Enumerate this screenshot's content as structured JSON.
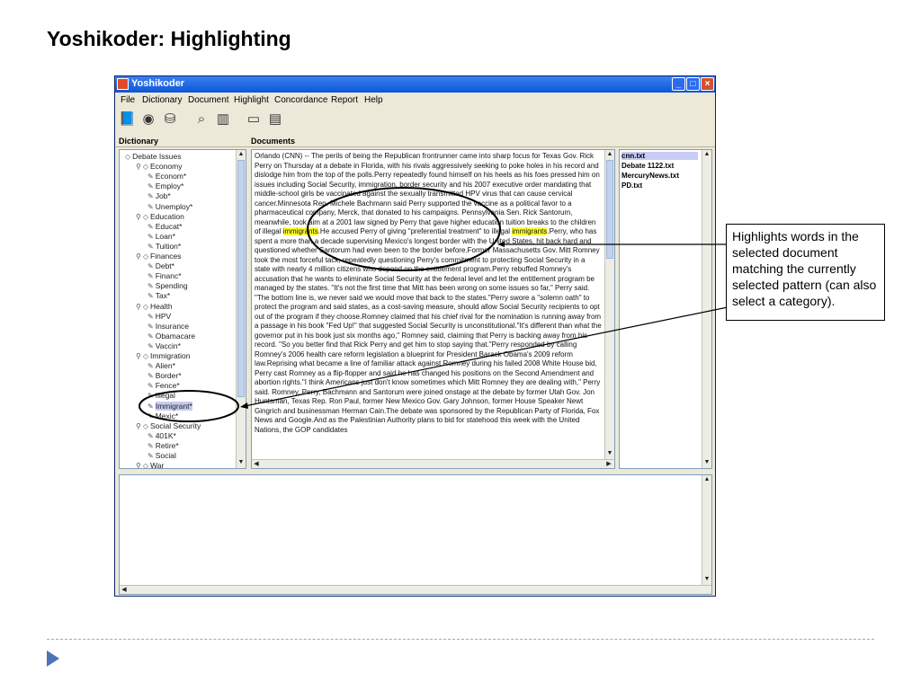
{
  "slide": {
    "title": "Yoshikoder: Highlighting"
  },
  "window": {
    "title": "Yoshikoder",
    "menus": [
      "File",
      "Dictionary",
      "Document",
      "Highlight",
      "Concordance",
      "Report",
      "Help"
    ],
    "toolbar_icons": [
      "book-icon",
      "open-document-icon",
      "jar-icon",
      "magnifier-icon",
      "columns-icon",
      "clipboard-icon",
      "export-icon"
    ]
  },
  "dictionary": {
    "label": "Dictionary",
    "tree": [
      {
        "text": "Debate Issues",
        "level": 0,
        "kind": "category"
      },
      {
        "text": "Economy",
        "level": 1,
        "kind": "category"
      },
      {
        "text": "Econom*",
        "level": 2,
        "kind": "pattern"
      },
      {
        "text": "Employ*",
        "level": 2,
        "kind": "pattern"
      },
      {
        "text": "Job*",
        "level": 2,
        "kind": "pattern"
      },
      {
        "text": "Unemploy*",
        "level": 2,
        "kind": "pattern"
      },
      {
        "text": "Education",
        "level": 1,
        "kind": "category"
      },
      {
        "text": "Educat*",
        "level": 2,
        "kind": "pattern"
      },
      {
        "text": "Loan*",
        "level": 2,
        "kind": "pattern"
      },
      {
        "text": "Tuition*",
        "level": 2,
        "kind": "pattern"
      },
      {
        "text": "Finances",
        "level": 1,
        "kind": "category"
      },
      {
        "text": "Debt*",
        "level": 2,
        "kind": "pattern"
      },
      {
        "text": "Financ*",
        "level": 2,
        "kind": "pattern"
      },
      {
        "text": "Spending",
        "level": 2,
        "kind": "pattern"
      },
      {
        "text": "Tax*",
        "level": 2,
        "kind": "pattern"
      },
      {
        "text": "Health",
        "level": 1,
        "kind": "category"
      },
      {
        "text": "HPV",
        "level": 2,
        "kind": "pattern"
      },
      {
        "text": "Insurance",
        "level": 2,
        "kind": "pattern"
      },
      {
        "text": "Obamacare",
        "level": 2,
        "kind": "pattern"
      },
      {
        "text": "Vaccin*",
        "level": 2,
        "kind": "pattern"
      },
      {
        "text": "Immigration",
        "level": 1,
        "kind": "category"
      },
      {
        "text": "Alien*",
        "level": 2,
        "kind": "pattern"
      },
      {
        "text": "Border*",
        "level": 2,
        "kind": "pattern"
      },
      {
        "text": "Fence*",
        "level": 2,
        "kind": "pattern"
      },
      {
        "text": "Illegal",
        "level": 2,
        "kind": "pattern"
      },
      {
        "text": "Immigrant*",
        "level": 2,
        "kind": "pattern",
        "selected": true
      },
      {
        "text": "Mexic*",
        "level": 2,
        "kind": "pattern"
      },
      {
        "text": "Social Security",
        "level": 1,
        "kind": "category"
      },
      {
        "text": "401K*",
        "level": 2,
        "kind": "pattern"
      },
      {
        "text": "Retire*",
        "level": 2,
        "kind": "pattern"
      },
      {
        "text": "Social",
        "level": 2,
        "kind": "pattern"
      },
      {
        "text": "War",
        "level": 1,
        "kind": "category"
      }
    ]
  },
  "documents": {
    "label": "Documents",
    "text_before_1": "Orlando (CNN) -- The perils of being the Republican frontrunner came into sharp focus for Texas Gov. Rick Perry on Thursday at a debate in Florida, with his rivals aggressively seeking to poke holes in his record and dislodge him from the top of the polls.Perry repeatedly found himself on his heels as his foes pressed him on issues including Social Security, immigration, border security and his 2007 executive order mandating that middle-school girls be vaccinated against the sexually transmitted HPV virus that can cause cervical cancer.Minnesota Rep. Michele Bachmann said Perry supported the vaccine as a political favor to a pharmaceutical company, Merck, that donated to his campaigns. Pennsylvania Sen. Rick Santorum, meanwhile, took aim at a 2001 law signed by Perry that gave higher education tuition breaks to the children of illegal ",
    "highlight_1": "immigrants",
    "text_between": ".He accused Perry of giving \"preferential treatment\" to illegal ",
    "highlight_2": "immigrants",
    "text_after": ".Perry, who has spent a more than a decade supervising Mexico's longest border with the United States, hit back hard and questioned whether Santorum had even been to the border before.Former Massachusetts Gov. Mitt Romney took the most forceful tack, repeatedly questioning Perry's commitment to protecting Social Security in a state with nearly 4 million citizens who depend on the entitlement program.Perry rebuffed Romney's accusation that he wants to eliminate Social Security at the federal level and let the entitlement program be managed by the states. \"It's not the first time that Mitt has been wrong on some issues so far,\" Perry said. \"The bottom line is, we never said we would move that back to the states.\"Perry swore a \"solemn oath\" to protect the program and said states, as a cost-saving measure, should allow Social Security recipients to opt out of the program if they choose.Romney claimed that his chief rival for the nomination is running away from a passage in his book \"Fed Up!\" that suggested Social Security is unconstitutional.\"It's different than what the governor put in his book just six months ago,\" Romney said, claiming that Perry is backing away from his record. \"So you better find that Rick Perry and get him to stop saying that.\"Perry responded by calling Romney's 2006 health care reform legislation a blueprint for President Barack Obama's 2009 reform law.Reprising what became a line of familiar attack against Romney during his failed 2008 White House bid, Perry cast Romney as a flip-flopper and said he has changed his positions on the Second Amendment and abortion rights.\"I think Americans just don't know sometimes which Mitt Romney they are dealing with,\" Perry said. Romney, Perry, Bachmann and Santorum were joined onstage at the debate by former Utah Gov. Jon Huntsman, Texas Rep. Ron Paul, former New Mexico Gov. Gary Johnson, former House Speaker Newt Gingrich and businessman Herman Cain.The debate was sponsored by the Republican Party of Florida, Fox News and Google.And as the Palestinian Authority plans to bid for statehood this week with the United Nations, the GOP candidates"
  },
  "files": {
    "items": [
      {
        "name": "cnn.txt",
        "selected": true
      },
      {
        "name": "Debate 1122.txt",
        "selected": false
      },
      {
        "name": "MercuryNews.txt",
        "selected": false
      },
      {
        "name": "PD.txt",
        "selected": false
      }
    ]
  },
  "callout": {
    "text": "Highlights words in the selected document matching the currently selected pattern (can also select a category)."
  },
  "colors": {
    "highlight": "#ffff33",
    "selection": "#c8cbf2",
    "titlebar": "#0d55d6"
  }
}
